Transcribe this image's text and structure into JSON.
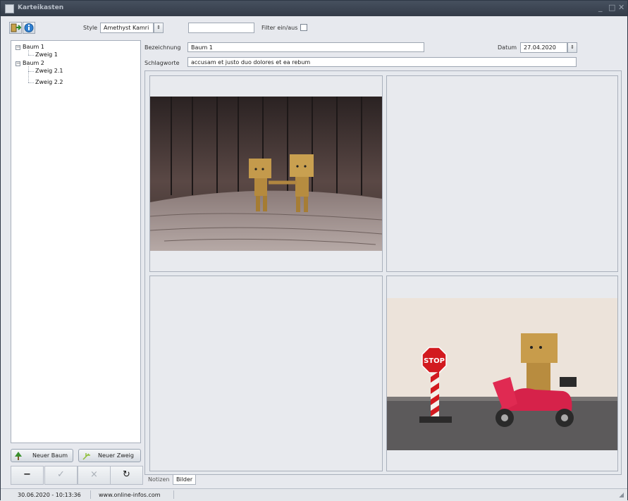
{
  "window": {
    "title": "Karteikasten"
  },
  "toolbar": {
    "style_label": "Style",
    "style_value": "Amethyst Kamri",
    "filter_value": "",
    "filter_label": "Filter ein/aus"
  },
  "tree": {
    "nodes": [
      {
        "label": "Baum 1"
      },
      {
        "label": "Zweig 1"
      },
      {
        "label": "Baum 2"
      },
      {
        "label": "Zweig 2.1"
      },
      {
        "label": "Zweig 2.2"
      }
    ]
  },
  "buttons": {
    "new_tree": "Neuer Baum",
    "new_branch": "Neuer Zweig"
  },
  "nav": {
    "minus": "−",
    "confirm": "✓",
    "cancel": "×",
    "refresh": "↻"
  },
  "form": {
    "bezeichnung_label": "Bezeichnung",
    "bezeichnung_value": "Baum 1",
    "datum_label": "Datum",
    "datum_value": "27.04.2020",
    "schlagworte_label": "Schlagworte",
    "schlagworte_value": "accusam et justo duo dolores et ea rebum"
  },
  "images": {
    "photo1_sign": "",
    "photo2_sign": "STOP"
  },
  "tabs": [
    {
      "label": "Notizen"
    },
    {
      "label": "Bilder"
    }
  ],
  "status": {
    "datetime": "30.06.2020 - 10:13:36",
    "website": "www.online-infos.com"
  },
  "colors": {
    "titlebar": "#3d4654",
    "accent_green": "#3a8f2e",
    "accent_blue": "#2f7fd0"
  }
}
